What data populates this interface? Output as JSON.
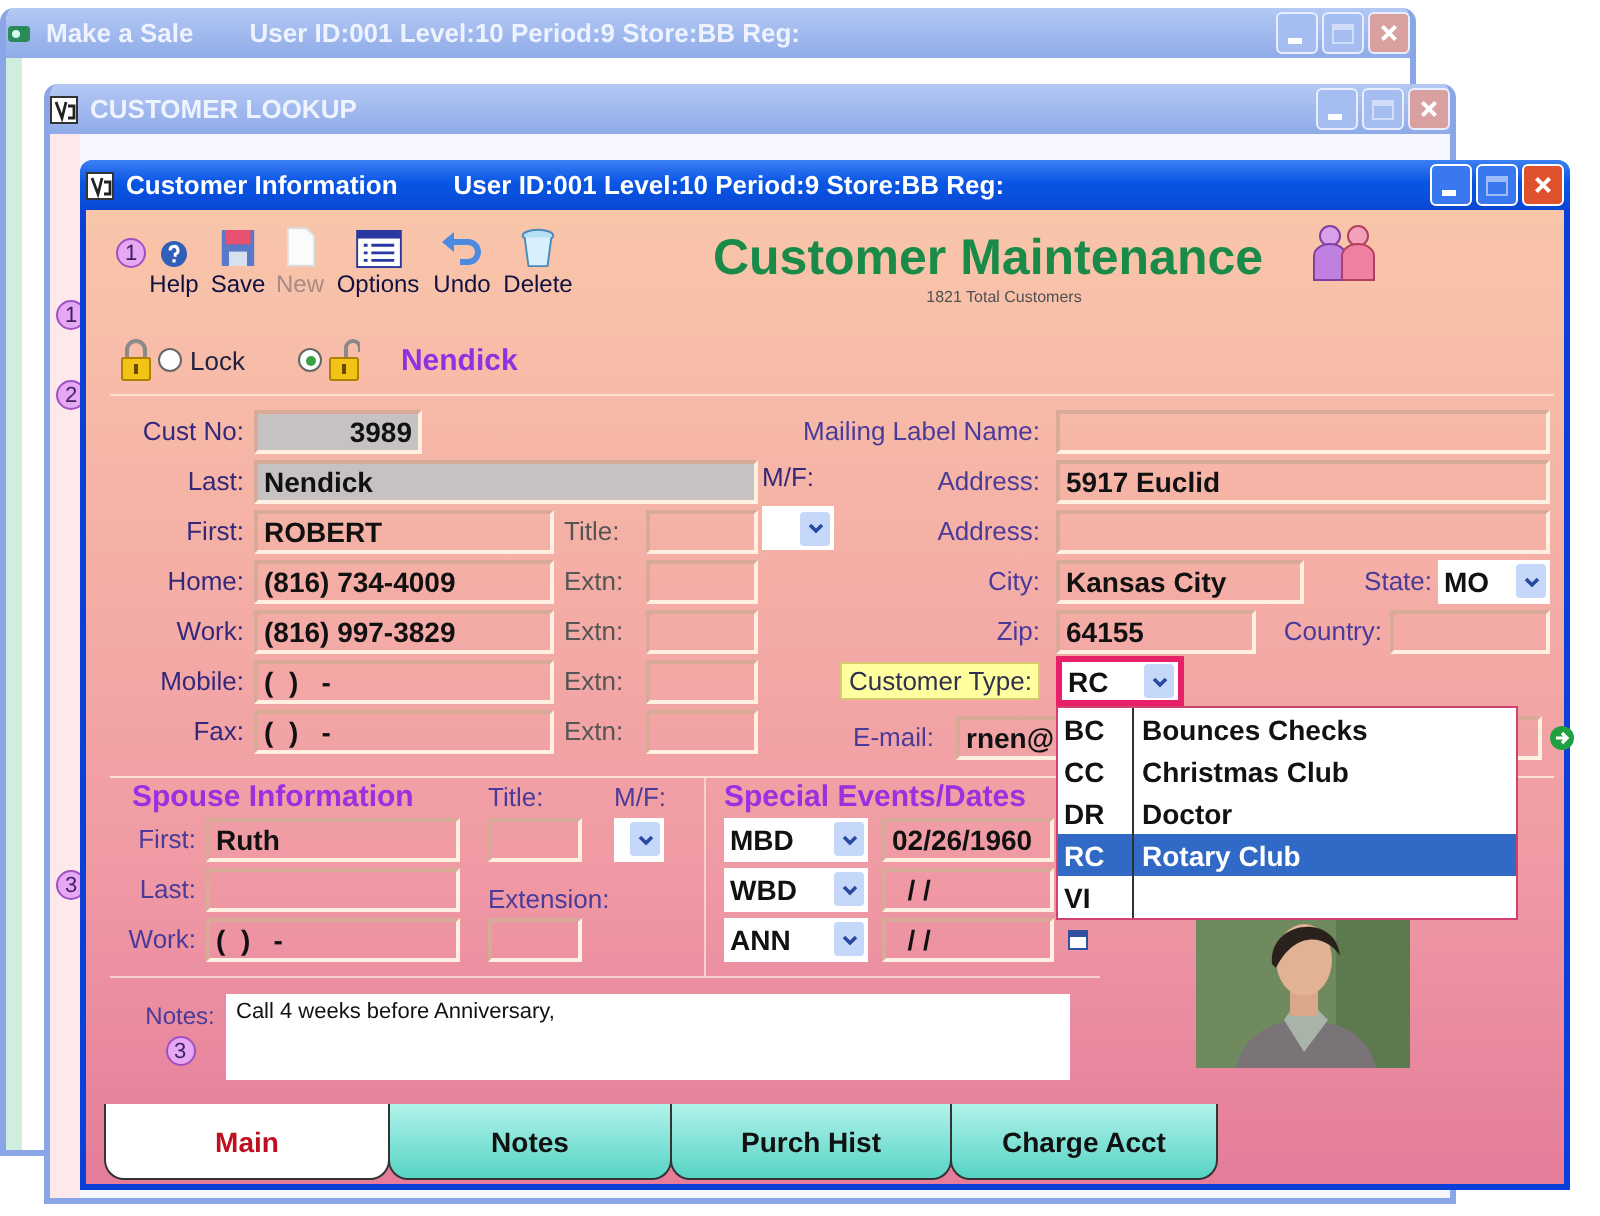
{
  "background_windows": [
    {
      "title": "Make a Sale",
      "info": "User ID:001 Level:10 Period:9 Store:BB Reg:"
    },
    {
      "title": "CUSTOMER  LOOKUP",
      "badges": [
        "1",
        "2",
        "3"
      ]
    }
  ],
  "window": {
    "title": "Customer Information",
    "info": "User ID:001 Level:10 Period:9 Store:BB Reg:"
  },
  "toolbar": {
    "badge": "1",
    "buttons": [
      {
        "kind": "help",
        "label": "Help",
        "disabled": false
      },
      {
        "kind": "save",
        "label": "Save",
        "disabled": false
      },
      {
        "kind": "new",
        "label": "New",
        "disabled": true
      },
      {
        "kind": "options",
        "label": "Options",
        "disabled": false
      },
      {
        "kind": "undo",
        "label": "Undo",
        "disabled": false
      },
      {
        "kind": "delete",
        "label": "Delete",
        "disabled": false
      }
    ]
  },
  "heading": {
    "title": "Customer Maintenance",
    "subtitle": "1821 Total Customers"
  },
  "lock": [
    {
      "kind": "locked",
      "label": "Lock",
      "selected": false
    },
    {
      "kind": "unlocked",
      "selected": true
    }
  ],
  "customer_name": "Nendick",
  "customer": {
    "cust_no": {
      "label": "Cust No:",
      "value": "3989"
    },
    "last": {
      "label": "Last:",
      "value": "Nendick"
    },
    "first": {
      "label": "First:",
      "value": "ROBERT",
      "side_label": "Title:"
    },
    "phones": [
      {
        "label": "Home:",
        "value": "(816) 734-4009",
        "side_label": "Extn:"
      },
      {
        "label": "Work:",
        "value": "(816) 997-3829",
        "side_label": "Extn:"
      },
      {
        "label": "Mobile:",
        "value": "(  )   -",
        "side_label": "Extn:"
      },
      {
        "label": "Fax:",
        "value": "(  )   -",
        "side_label": "Extn:"
      }
    ],
    "gender": {
      "label": "M/F:"
    },
    "mailing_label": {
      "label": "Mailing Label Name:"
    },
    "address": [
      {
        "label": "Address:",
        "value": "5917 Euclid"
      },
      {
        "label": "Address:"
      }
    ],
    "city": {
      "label": "City:",
      "value": "Kansas City"
    },
    "state": {
      "label": "State:",
      "value": "MO"
    },
    "zip": {
      "label": "Zip:",
      "value": "64155"
    },
    "country": {
      "label": "Country:"
    },
    "customer_type": {
      "label": "Customer Type:",
      "value": "RC",
      "expanded": true
    },
    "email": {
      "label": "E-mail:",
      "value": "rnen@"
    }
  },
  "customer_type_options": [
    {
      "code": "BC",
      "name": "Bounces Checks",
      "selected": false
    },
    {
      "code": "CC",
      "name": "Christmas Club",
      "selected": false
    },
    {
      "code": "DR",
      "name": "Doctor",
      "selected": false
    },
    {
      "code": "RC",
      "name": "Rotary Club",
      "selected": true
    },
    {
      "code": "VI",
      "selected": false
    }
  ],
  "spouse": {
    "heading": "Spouse Information",
    "title_label": "Title:",
    "gender_label": "M/F:",
    "extension_label": "Extension:",
    "rows": [
      {
        "label": "First:",
        "value": "Ruth"
      },
      {
        "label": "Last:"
      },
      {
        "label": "Work:",
        "value": "(  )   -"
      }
    ]
  },
  "special_events": {
    "heading": "Special Events/Dates",
    "events": [
      {
        "type": "MBD",
        "date": "02/26/1960"
      },
      {
        "type": "WBD",
        "date": "  / /"
      },
      {
        "type": "ANN",
        "date": "  / /"
      }
    ]
  },
  "notes": {
    "label": "Notes:",
    "badge": "3",
    "value": "Call 4 weeks before Anniversary,"
  },
  "tabs": [
    {
      "label": "Main",
      "selected": true
    },
    {
      "label": "Notes",
      "selected": false
    },
    {
      "label": "Purch Hist",
      "selected": false
    },
    {
      "label": "Charge Acct",
      "selected": false
    }
  ]
}
